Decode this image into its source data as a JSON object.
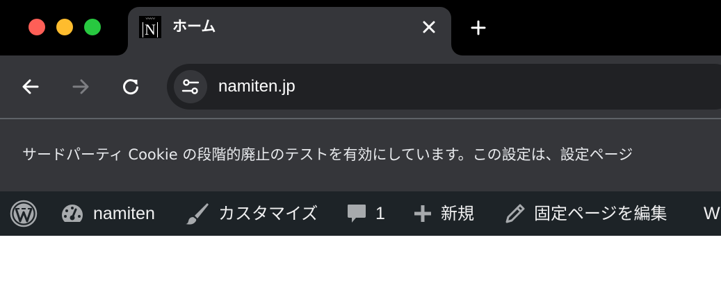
{
  "tab": {
    "title": "ホーム",
    "favicon_letter": "N",
    "favicon_wave": "〰〰"
  },
  "toolbar": {
    "url": "namiten.jp"
  },
  "infobar": {
    "message": "サードパーティ Cookie の段階的廃止のテストを有効にしています。この設定は、設定ページ"
  },
  "adminbar": {
    "site_name": "namiten",
    "customize": "カスタマイズ",
    "comments_count": "1",
    "new": "新規",
    "edit_page": "固定ページを編集",
    "more": "W"
  },
  "colors": {
    "tabstrip": "#000000",
    "toolbar": "#35363a",
    "omnibox": "#202124",
    "adminbar": "#1d2327",
    "adminbar_icon": "#a7aaad",
    "close": "#fe5f57",
    "minimize": "#febc2e",
    "maximize": "#28c840"
  }
}
